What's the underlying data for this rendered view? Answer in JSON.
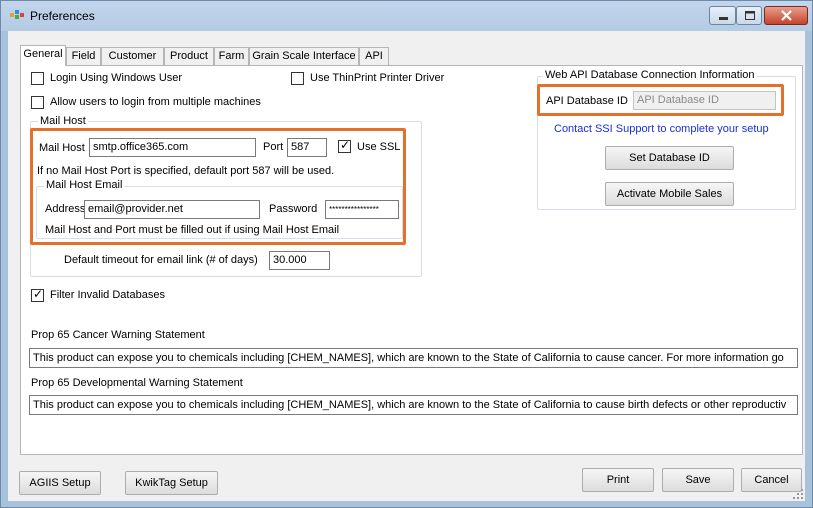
{
  "window": {
    "title": "Preferences",
    "icon": "preferences-app-icon",
    "controls": [
      "minimize-icon",
      "maximize-icon",
      "close-icon"
    ]
  },
  "tabs": [
    {
      "label": "General",
      "active": true
    },
    {
      "label": "Field"
    },
    {
      "label": "Customer"
    },
    {
      "label": "Product"
    },
    {
      "label": "Farm"
    },
    {
      "label": "Grain Scale Interface"
    },
    {
      "label": "API"
    }
  ],
  "general": {
    "login_windows_user": {
      "label": "Login Using Windows User",
      "checked": false
    },
    "thinprint": {
      "label": "Use ThinPrint Printer Driver",
      "checked": false
    },
    "multi_machine": {
      "label": "Allow users to login from multiple machines",
      "checked": false
    },
    "filter_invalid": {
      "label": "Filter Invalid Databases",
      "checked": true
    },
    "check_mark": "✓"
  },
  "mail_host": {
    "group_label": "Mail Host",
    "host_label": "Mail Host",
    "host_value": "smtp.office365.com",
    "port_label": "Port",
    "port_value": "587",
    "ssl_label": "Use SSL",
    "ssl_checked": true,
    "note": "If no Mail Host Port is specified, default port 587 will be used.",
    "email": {
      "group_label": "Mail Host Email",
      "address_label": "Address",
      "address_value": "email@provider.net",
      "password_label": "Password",
      "password_value": "****************",
      "note": "Mail Host and Port must be filled out if using Mail Host Email"
    },
    "timeout_label": "Default timeout for email link (# of days)",
    "timeout_value": "30.000"
  },
  "web_api": {
    "group_label": "Web API Database Connection Information",
    "db_id_label": "API Database ID",
    "db_id_placeholder": "API Database ID",
    "contact_text": "Contact SSI Support to complete your setup",
    "set_db_button": "Set Database ID",
    "activate_button": "Activate Mobile Sales"
  },
  "prop65": {
    "cancer_label": "Prop 65 Cancer Warning Statement",
    "cancer_value": "This product can expose you to chemicals including [CHEM_NAMES], which are known to the State of California to cause cancer.  For more information go",
    "dev_label": "Prop 65 Developmental Warning Statement",
    "dev_value": "This product can expose you to chemicals including [CHEM_NAMES], which are known to the State of California to cause birth defects or other reproductiv"
  },
  "footer": {
    "agiis": "AGIIS Setup",
    "kwiktag": "KwikTag Setup",
    "print": "Print",
    "save": "Save",
    "cancel": "Cancel"
  },
  "colors": {
    "highlight": "#e4712b",
    "link": "#1a2fd6",
    "titlebar": "#b9d0e8"
  }
}
